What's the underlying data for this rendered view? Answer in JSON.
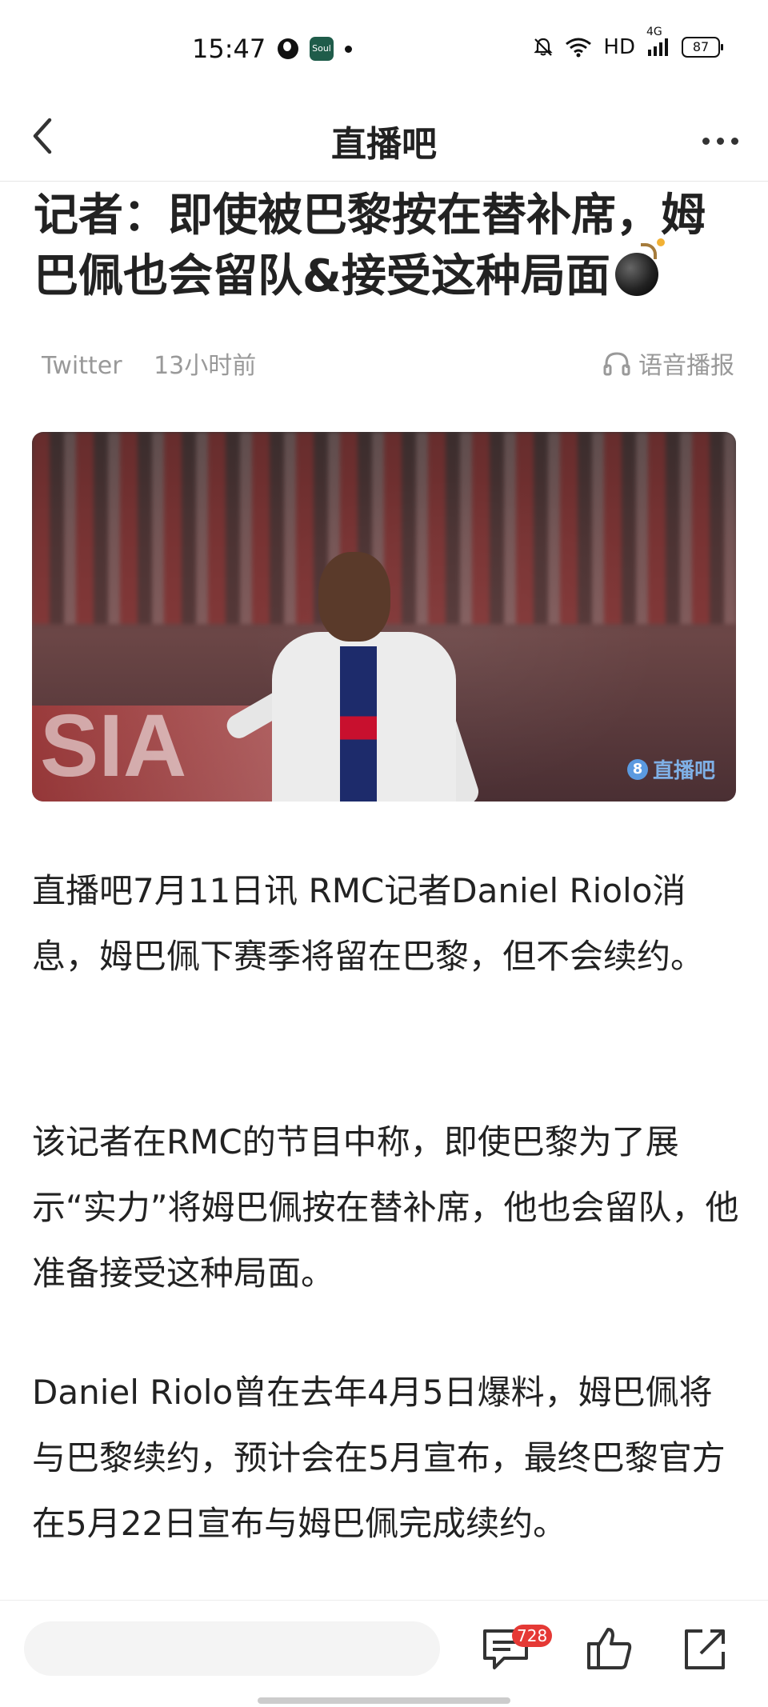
{
  "status_bar": {
    "time": "15:47",
    "network": "HD",
    "signal": "4G",
    "battery": "87"
  },
  "header": {
    "title": "直播吧"
  },
  "article": {
    "title": "记者：即使被巴黎按在替补席，姆巴佩也会留队&接受这种局面",
    "source": "Twitter",
    "time": "13小时前",
    "tts_label": "语音播报",
    "image_watermark": "直播吧",
    "image_watermark_logo": "8",
    "paragraphs": [
      "直播吧7月11日讯 RMC记者Daniel Riolo消息，姆巴佩下赛季将留在巴黎，但不会续约。",
      "该记者在RMC的节目中称，即使巴黎为了展示“实力”将姆巴佩按在替补席，他也会留队，他准备接受这种局面。",
      "Daniel Riolo曾在去年4月5日爆料，姆巴佩将与巴黎续约，预计会在5月宣布，最终巴黎官方在5月22日宣布与姆巴佩完成续约。"
    ]
  },
  "bottom_bar": {
    "comment_count": "728"
  },
  "colors": {
    "accent_red": "#e53935",
    "text_primary": "#222222",
    "text_secondary": "#999999"
  },
  "icons": {
    "back": "back-arrow-icon",
    "more": "more-dots-icon",
    "tts": "headphones-icon",
    "comment": "comment-icon",
    "like": "thumbs-up-icon",
    "share": "share-icon",
    "title_emoji": "bomb-icon"
  }
}
